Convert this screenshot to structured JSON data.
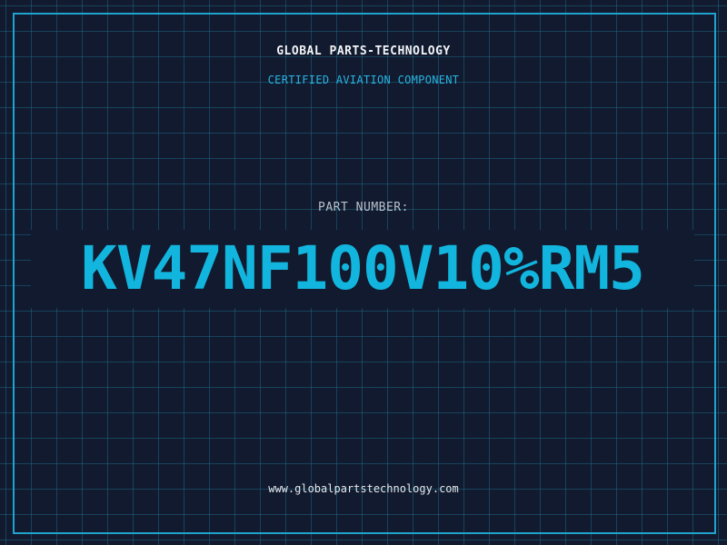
{
  "header": {
    "brand": "GLOBAL PARTS-TECHNOLOGY",
    "subtitle": "CERTIFIED AVIATION COMPONENT"
  },
  "part": {
    "label": "PART NUMBER:",
    "number": "KV47NF100V10%RM5"
  },
  "footer": {
    "website": "www.globalpartstechnology.com"
  },
  "colors": {
    "background": "#111a2e",
    "grid": "#1c6482",
    "frame": "#1fa3cf",
    "accent": "#12b5dd"
  }
}
